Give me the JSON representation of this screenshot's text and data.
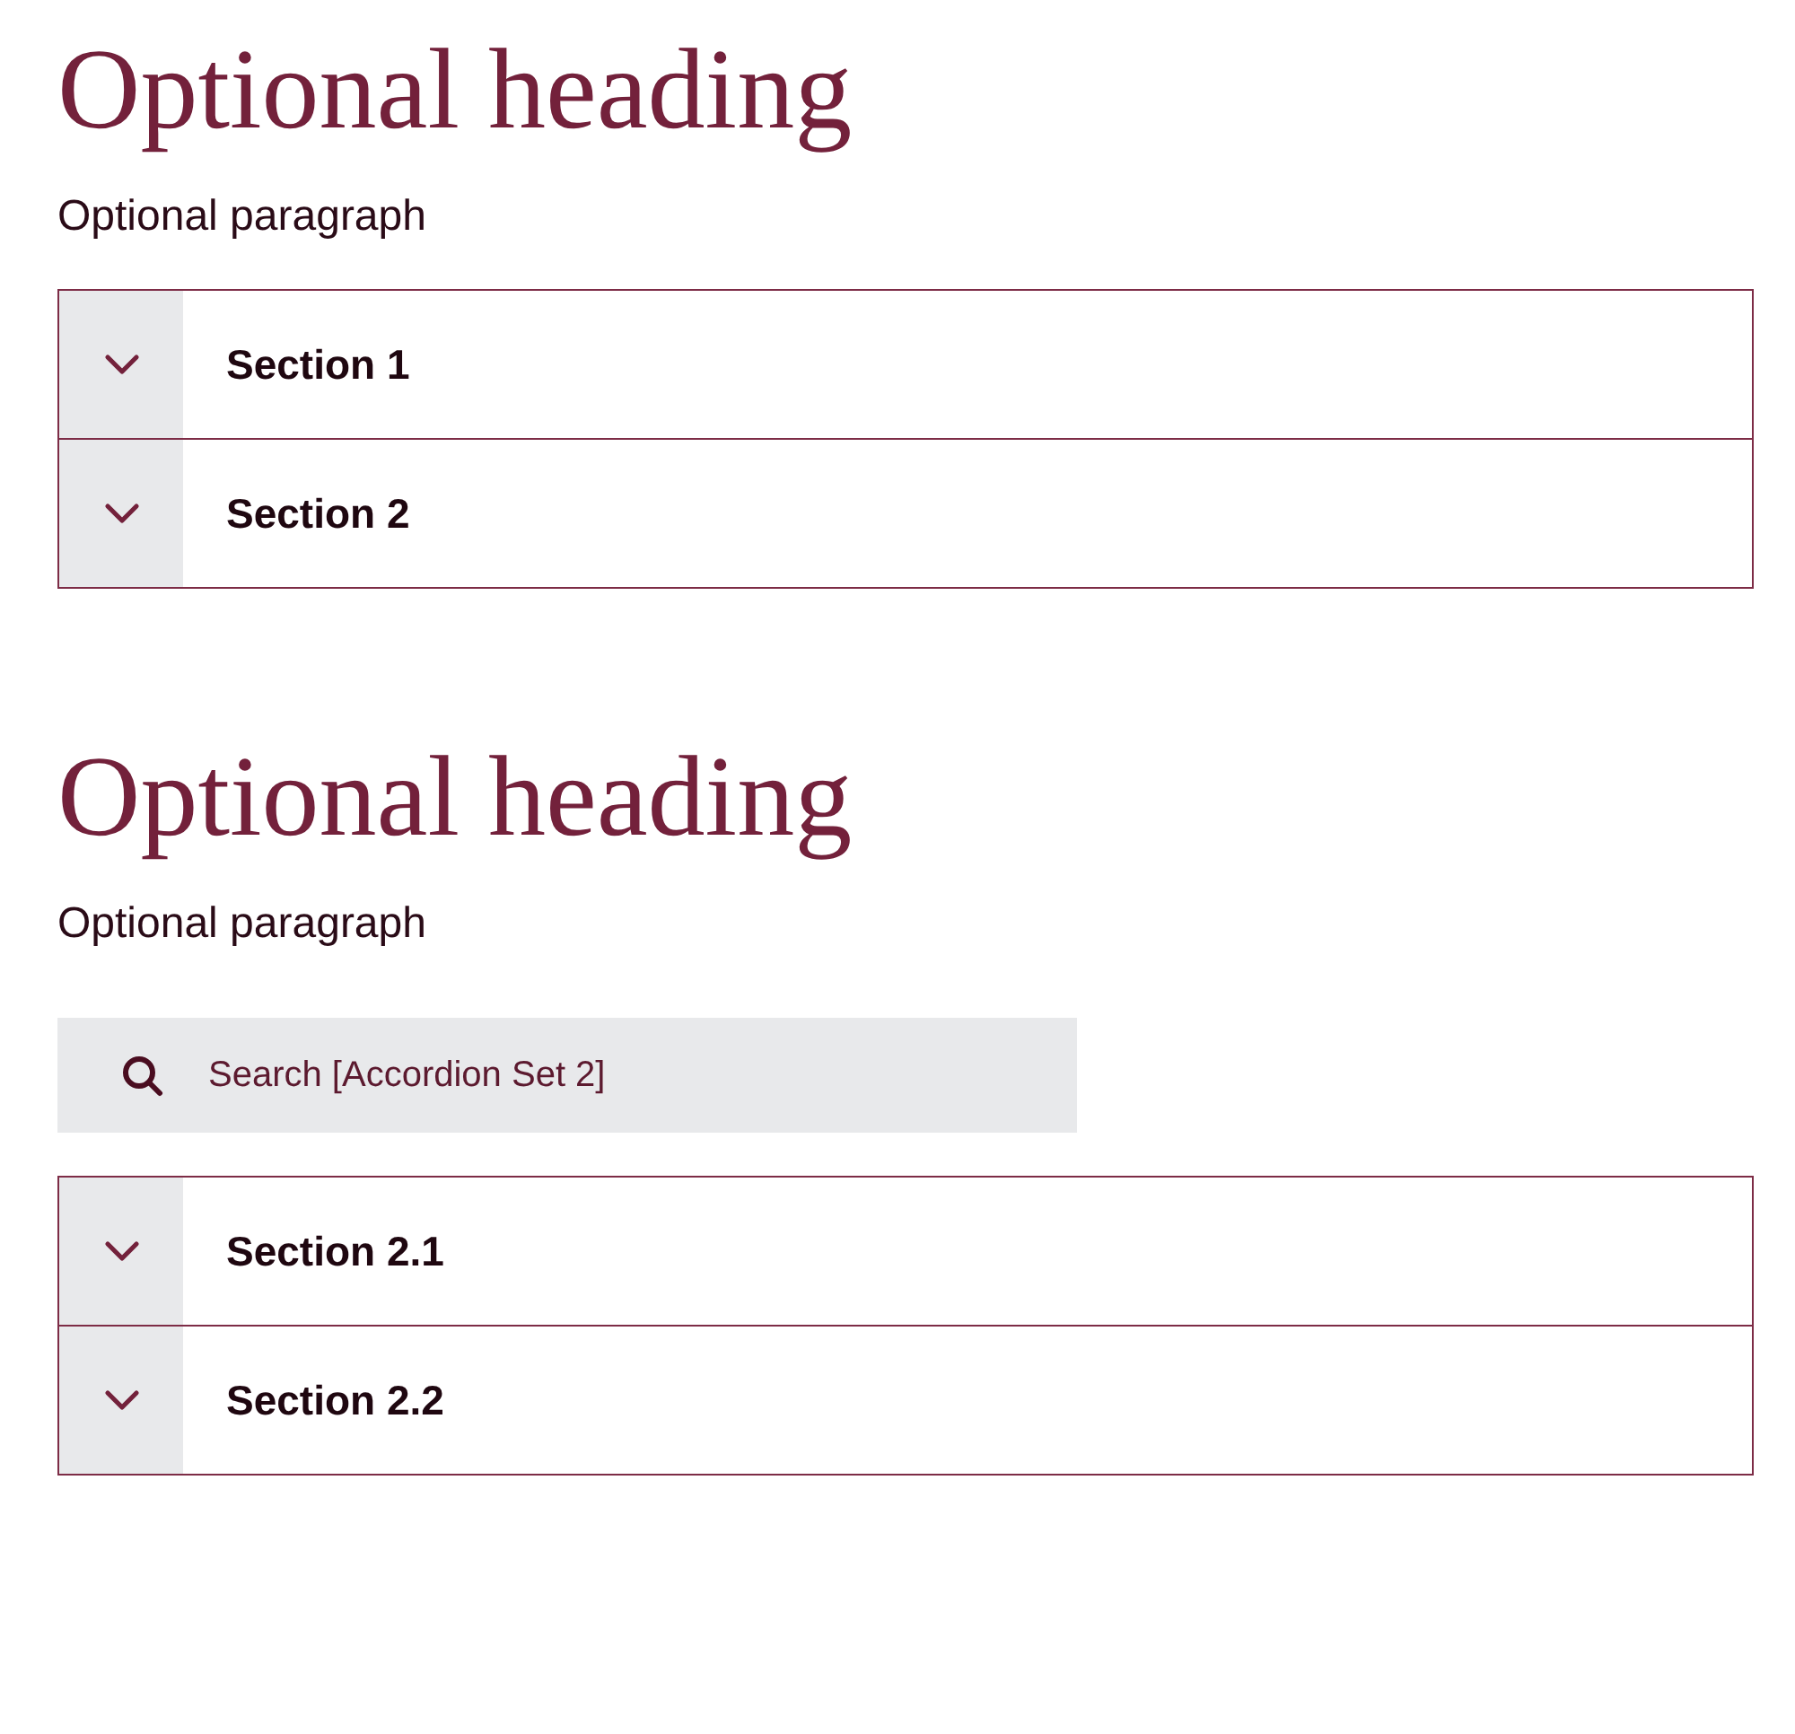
{
  "sections": [
    {
      "heading": "Optional heading",
      "paragraph": "Optional paragraph",
      "accordion": [
        {
          "label": "Section 1",
          "expanded": false
        },
        {
          "label": "Section 2",
          "expanded": false
        }
      ]
    },
    {
      "heading": "Optional heading",
      "paragraph": "Optional paragraph",
      "search": {
        "placeholder": "Search [Accordion Set 2]"
      },
      "accordion": [
        {
          "label": "Section 2.1",
          "expanded": false
        },
        {
          "label": "Section 2.2",
          "expanded": false
        }
      ]
    }
  ]
}
